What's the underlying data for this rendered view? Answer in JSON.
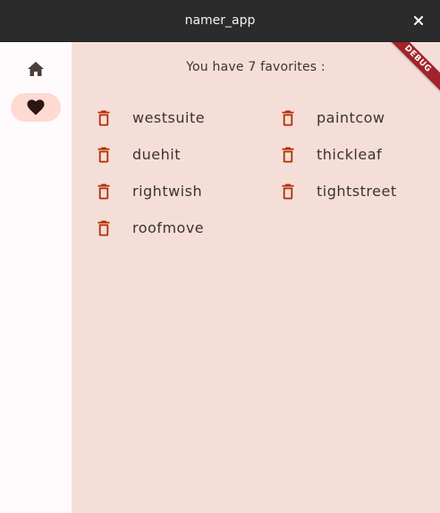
{
  "window": {
    "title": "namer_app",
    "close_icon": "close-icon"
  },
  "rail": {
    "items": [
      {
        "id": "home",
        "icon": "home-icon",
        "selected": false
      },
      {
        "id": "favorites",
        "icon": "heart-icon",
        "selected": true
      }
    ]
  },
  "favorites": {
    "heading": "You have 7 favorites :",
    "delete_icon": "trash-icon",
    "items": [
      "westsuite",
      "paintcow",
      "duehit",
      "thickleaf",
      "rightwish",
      "tightstreet",
      "roofmove"
    ]
  },
  "debug_banner": "DEBUG",
  "colors": {
    "titlebar": "#2b2b2b",
    "rail_bg": "#fffbfd",
    "rail_selected": "#ffdad2",
    "content_bg": "#f5ded8",
    "accent": "#b32e00",
    "text": "#3b3331",
    "banner": "#a3222b"
  }
}
